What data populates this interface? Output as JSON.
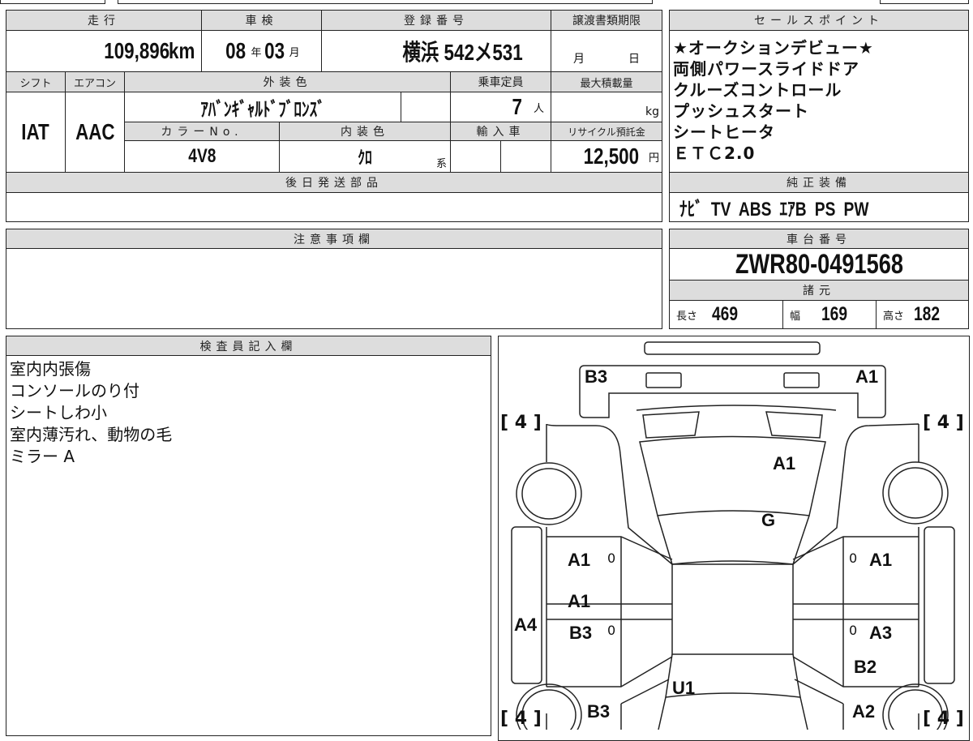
{
  "main_table": {
    "headers": {
      "mileage": "走行",
      "inspection": "車検",
      "registration": "登録番号",
      "transfer_deadline": "譲渡書類期限",
      "shift": "シフト",
      "aircon": "エアコン",
      "exterior_color": "外装色",
      "capacity": "乗車定員",
      "max_load": "最大積載量",
      "color_no": "カラーNo.",
      "interior_color": "内装色",
      "imported": "輸入車",
      "recycle_fee": "リサイクル預託金",
      "later_parts": "後日発送部品"
    },
    "mileage": "109,896",
    "mileage_unit": "km",
    "inspection_year": "08",
    "year_unit": "年",
    "inspection_month": "03",
    "month_unit": "月",
    "registration": "横浜 542メ531",
    "deadline_month": "月",
    "deadline_day": "日",
    "shift": "IAT",
    "aircon": "AAC",
    "exterior_color": "ｱﾊﾞﾝｷﾞｬﾙﾄﾞﾌﾞﾛﾝｽﾞ",
    "capacity": "7",
    "capacity_unit": "人",
    "load_unit": "kg",
    "color_no": "4V8",
    "interior_color": "ｸﾛ",
    "interior_suffix": "系",
    "recycle_fee": "12,500",
    "yen": "円"
  },
  "sales_points": {
    "title": "セールスポイント",
    "items": [
      "★オークションデビュー★",
      "両側パワースライドドア",
      "クルーズコントロール",
      "プッシュスタート",
      "シートヒータ",
      "ＥＴＣ2.0"
    ]
  },
  "equipment": {
    "title": "純正装備",
    "value": "ﾅﾋﾞ TV ABS ｴｱB PS PW"
  },
  "notes": {
    "title": "注意事項欄"
  },
  "chassis": {
    "title": "車台番号",
    "value": "ZWR80-0491568",
    "spec_title": "諸元",
    "length_label": "長さ",
    "length": "469",
    "width_label": "幅",
    "width": "169",
    "height_label": "高さ",
    "height": "182"
  },
  "inspector": {
    "title": "検査員記入欄",
    "lines": [
      "室内内張傷",
      "コンソールのり付",
      "シートしわ小",
      "室内薄汚れ、動物の毛",
      "ミラー A"
    ]
  },
  "diagram": {
    "labels": {
      "front_left": "B3",
      "front_right": "A1",
      "hood": "A1",
      "windshield": "G",
      "lf_door": "A1",
      "rf_door": "A1",
      "lr_door": "A1",
      "l_rail": "A4",
      "lr_door2": "B3",
      "rr_door": "A3",
      "r_quarter": "B2",
      "rear": "U1",
      "l_quarter": "B3",
      "r_rear": "A2"
    },
    "tire": "4",
    "zero": "0"
  }
}
